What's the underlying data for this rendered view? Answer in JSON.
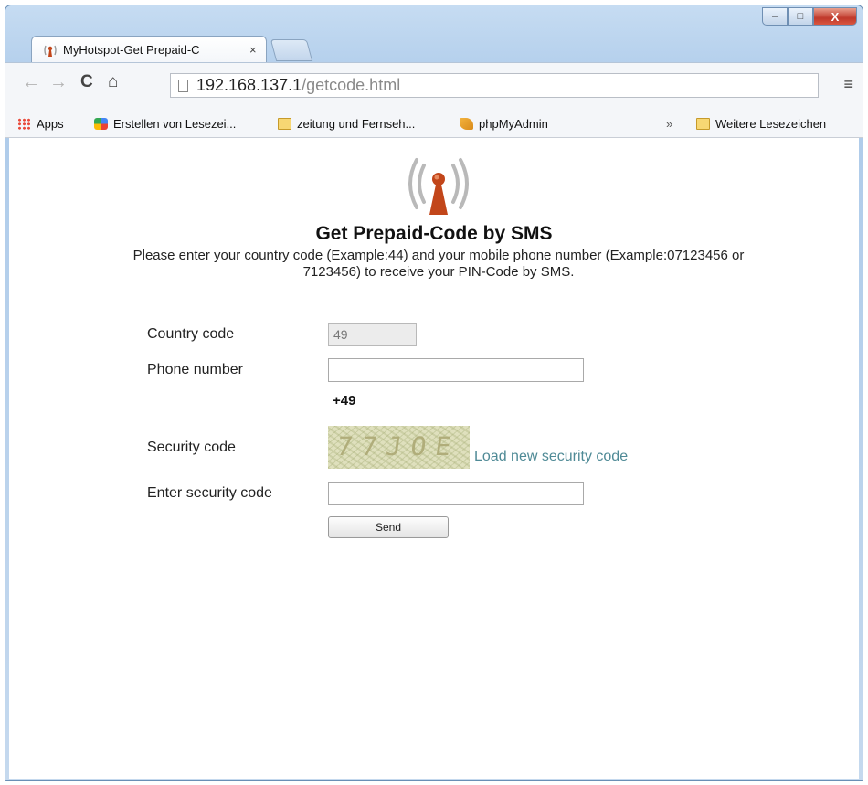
{
  "browser": {
    "tab_title": "MyHotspot-Get Prepaid-C",
    "tab_close": "×",
    "address": {
      "host": "192.168.137.1",
      "path": "/getcode.html"
    },
    "window_controls": {
      "minimize": "–",
      "maximize": "□",
      "close": "X"
    },
    "menu": "≡"
  },
  "bookmarks": {
    "items": [
      {
        "label": "Apps",
        "icon": "apps-grid-icon"
      },
      {
        "label": "Erstellen von Lesezei...",
        "icon": "bookmark-app-icon"
      },
      {
        "label": "zeitung und Fernseh...",
        "icon": "folder-icon"
      },
      {
        "label": "phpMyAdmin",
        "icon": "phpmyadmin-icon"
      }
    ],
    "overflow": "»",
    "other": "Weitere Lesezeichen"
  },
  "page": {
    "title": "Get Prepaid-Code by SMS",
    "description": "Please enter your country code (Example:44) and your mobile phone number (Example:07123456 or 7123456) to receive your PIN-Code by SMS.",
    "form": {
      "country_code_label": "Country code",
      "country_code_value": "49",
      "phone_label": "Phone number",
      "phone_value": "",
      "prefix": "+49",
      "security_label": "Security code",
      "captcha_text": "77JOE",
      "load_new": "Load new security code",
      "enter_security_label": "Enter security code",
      "enter_security_value": "",
      "send_label": "Send"
    }
  },
  "colors": {
    "link": "#4f8a96",
    "antenna": "#c2461a"
  }
}
